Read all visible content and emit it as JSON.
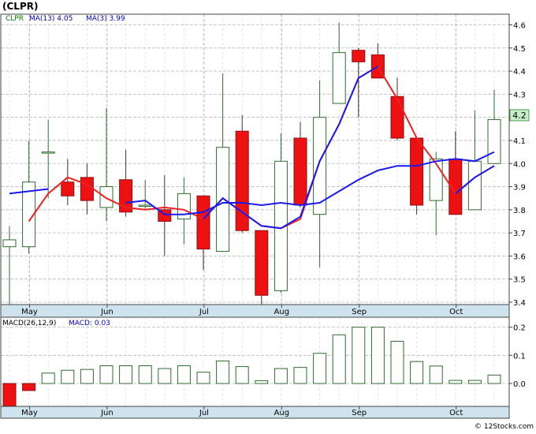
{
  "chart_data": [
    {
      "type": "candlestick",
      "title": "(CLPR)",
      "legend": [
        {
          "label": "CLPR",
          "color": "#008000"
        },
        {
          "label": "MA(13)  4.05",
          "color": "#0000cc"
        },
        {
          "label": "MA(3)  3.99",
          "color": "#0000cc"
        }
      ],
      "price_tag": "4.2",
      "ylim": [
        3.38,
        4.66
      ],
      "yticks": [
        "3.4",
        "3.5",
        "3.6",
        "3.7",
        "3.8",
        "3.9",
        "4.0",
        "4.1",
        "4.2",
        "4.3",
        "4.4",
        "4.5",
        "4.6"
      ],
      "x_labels": [
        {
          "label": "May",
          "week": 1.2
        },
        {
          "label": "Jun",
          "week": 5.2
        },
        {
          "label": "Jul",
          "week": 10.2
        },
        {
          "label": "Aug",
          "week": 14.2
        },
        {
          "label": "Sep",
          "week": 18.2
        },
        {
          "label": "Oct",
          "week": 23.2
        }
      ],
      "candles": [
        {
          "o": 3.64,
          "h": 3.73,
          "l": 3.38,
          "c": 3.67
        },
        {
          "o": 3.64,
          "h": 4.1,
          "l": 3.61,
          "c": 3.92
        },
        {
          "o": 4.05,
          "h": 4.19,
          "l": 3.85,
          "c": 4.05
        },
        {
          "o": 3.92,
          "h": 4.02,
          "l": 3.82,
          "c": 3.86
        },
        {
          "o": 3.94,
          "h": 4.0,
          "l": 3.78,
          "c": 3.84
        },
        {
          "o": 3.81,
          "h": 4.24,
          "l": 3.75,
          "c": 3.9
        },
        {
          "o": 3.93,
          "h": 4.06,
          "l": 3.77,
          "c": 3.79
        },
        {
          "o": 3.82,
          "h": 3.93,
          "l": 3.8,
          "c": 3.82
        },
        {
          "o": 3.8,
          "h": 3.95,
          "l": 3.6,
          "c": 3.75
        },
        {
          "o": 3.76,
          "h": 3.94,
          "l": 3.65,
          "c": 3.87
        },
        {
          "o": 3.86,
          "h": 3.86,
          "l": 3.54,
          "c": 3.63
        },
        {
          "o": 3.62,
          "h": 4.39,
          "l": 3.62,
          "c": 4.07
        },
        {
          "o": 4.14,
          "h": 4.21,
          "l": 3.7,
          "c": 3.71
        },
        {
          "o": 3.71,
          "h": 3.71,
          "l": 3.38,
          "c": 3.43
        },
        {
          "o": 3.45,
          "h": 4.13,
          "l": 3.44,
          "c": 4.01
        },
        {
          "o": 4.11,
          "h": 4.18,
          "l": 3.81,
          "c": 3.82
        },
        {
          "o": 3.78,
          "h": 4.36,
          "l": 3.55,
          "c": 4.2
        },
        {
          "o": 4.26,
          "h": 4.61,
          "l": 4.26,
          "c": 4.48
        },
        {
          "o": 4.49,
          "h": 4.5,
          "l": 4.2,
          "c": 4.44
        },
        {
          "o": 4.47,
          "h": 4.52,
          "l": 4.37,
          "c": 4.37
        },
        {
          "o": 4.29,
          "h": 4.37,
          "l": 4.1,
          "c": 4.11
        },
        {
          "o": 4.11,
          "h": 4.11,
          "l": 3.78,
          "c": 3.82
        },
        {
          "o": 3.84,
          "h": 4.05,
          "l": 3.69,
          "c": 4.02
        },
        {
          "o": 4.02,
          "h": 4.14,
          "l": 3.78,
          "c": 3.78
        },
        {
          "o": 3.8,
          "h": 4.23,
          "l": 3.8,
          "c": 4.01
        },
        {
          "o": 4.0,
          "h": 4.32,
          "l": 4.0,
          "c": 4.19
        }
      ],
      "ma13": [
        {
          "w": 0,
          "v": 3.87
        },
        {
          "w": 3,
          "v": 3.89
        },
        {
          "w": 6,
          "v": 3.83
        },
        {
          "w": 7,
          "v": 3.84
        },
        {
          "w": 8,
          "v": 3.78
        },
        {
          "w": 9,
          "v": 3.78
        },
        {
          "w": 10,
          "v": 3.79
        },
        {
          "w": 11,
          "v": 3.83
        },
        {
          "w": 12,
          "v": 3.83
        },
        {
          "w": 13,
          "v": 3.82
        },
        {
          "w": 14,
          "v": 3.83
        },
        {
          "w": 15,
          "v": 3.82
        },
        {
          "w": 16,
          "v": 3.83
        },
        {
          "w": 17,
          "v": 3.88
        },
        {
          "w": 18,
          "v": 3.93
        },
        {
          "w": 19,
          "v": 3.97
        },
        {
          "w": 20,
          "v": 3.99
        },
        {
          "w": 21,
          "v": 3.99
        },
        {
          "w": 22,
          "v": 4.01
        },
        {
          "w": 23,
          "v": 4.02
        },
        {
          "w": 24,
          "v": 4.01
        },
        {
          "w": 25,
          "v": 4.05
        }
      ],
      "ma3": [
        {
          "w": 1,
          "v": 3.75
        },
        {
          "w": 2,
          "v": 3.87
        },
        {
          "w": 3,
          "v": 3.94
        },
        {
          "w": 4,
          "v": 3.91
        },
        {
          "w": 5,
          "v": 3.85
        },
        {
          "w": 6,
          "v": 3.81
        },
        {
          "w": 7,
          "v": 3.8
        },
        {
          "w": 8,
          "v": 3.81
        },
        {
          "w": 9,
          "v": 3.8
        },
        {
          "w": 10,
          "v": 3.76
        },
        {
          "w": 11,
          "v": 3.85
        },
        {
          "w": 12,
          "v": 3.79
        },
        {
          "w": 13,
          "v": 3.73
        },
        {
          "w": 14,
          "v": 3.72
        },
        {
          "w": 15,
          "v": 3.76
        },
        {
          "w": 16,
          "v": 4.01
        },
        {
          "w": 17,
          "v": 4.17
        },
        {
          "w": 18,
          "v": 4.37
        },
        {
          "w": 19,
          "v": 4.42
        },
        {
          "w": 20,
          "v": 4.28
        },
        {
          "w": 21,
          "v": 4.11
        },
        {
          "w": 22,
          "v": 4.0
        },
        {
          "w": 23,
          "v": 3.87
        },
        {
          "w": 24,
          "v": 3.94
        },
        {
          "w": 25,
          "v": 3.99
        }
      ],
      "ma3_overlay": [
        {
          "w": 10,
          "v": 3.76
        },
        {
          "w": 11,
          "v": 3.85
        },
        {
          "w": 12,
          "v": 3.79
        },
        {
          "w": 13,
          "v": 3.73
        },
        {
          "w": 14,
          "v": 3.72
        },
        {
          "w": 15,
          "v": 3.77
        },
        {
          "w": 16,
          "v": 4.01
        },
        {
          "w": 17,
          "v": 4.17
        },
        {
          "w": 18,
          "v": 4.37
        },
        {
          "w": 19,
          "v": 4.42
        }
      ],
      "ma3_tail": [
        {
          "w": 23,
          "v": 3.87
        },
        {
          "w": 24,
          "v": 3.94
        },
        {
          "w": 25,
          "v": 3.99
        }
      ],
      "ma13_head": [
        {
          "w": 0,
          "v": 3.87
        },
        {
          "w": 2,
          "v": 3.89
        }
      ],
      "ma13_mid": [
        {
          "w": 6,
          "v": 3.83
        },
        {
          "w": 7,
          "v": 3.84
        }
      ]
    },
    {
      "type": "bar",
      "title": "MACD(26,12,9)",
      "legend_label": "MACD",
      "legend_value": "MACD: 0.03",
      "ylim": [
        -0.085,
        0.26
      ],
      "yticks": [
        "0.0",
        "0.1",
        "0.2"
      ],
      "values": [
        -0.08,
        -0.025,
        0.037,
        0.047,
        0.05,
        0.063,
        0.063,
        0.063,
        0.053,
        0.063,
        0.04,
        0.08,
        0.06,
        0.01,
        0.053,
        0.057,
        0.107,
        0.173,
        0.2,
        0.2,
        0.15,
        0.078,
        0.062,
        0.011,
        0.011,
        0.03
      ]
    }
  ],
  "watermark": "© 12Stocks.com"
}
